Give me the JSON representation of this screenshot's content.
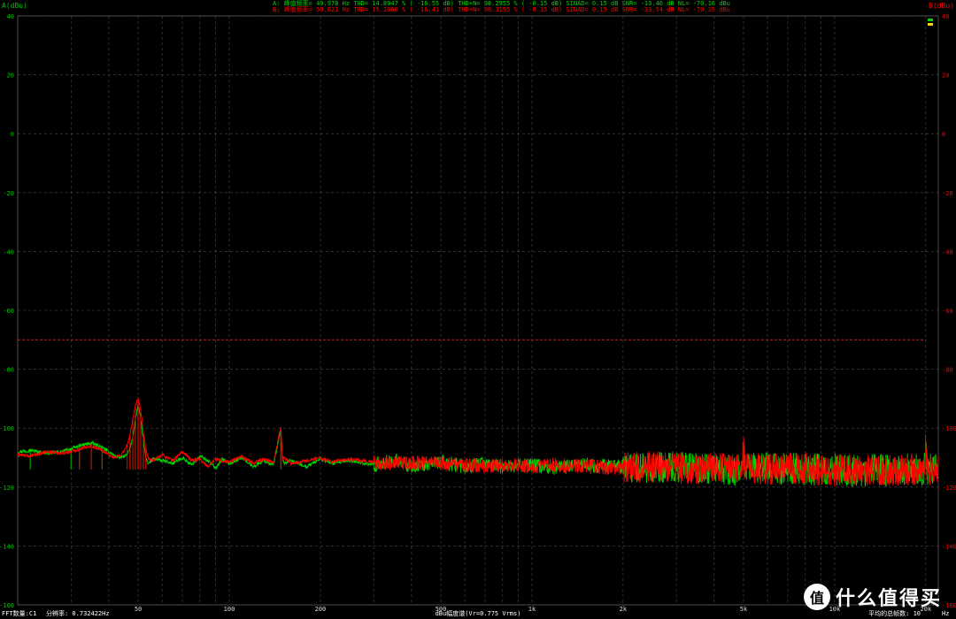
{
  "colors": {
    "background": "#000000",
    "grid": "#4d4d4d",
    "channel_a": "#00d400",
    "channel_b": "#ff0000",
    "axis_left": "#00c000",
    "axis_right": "#ff0000",
    "tick_text": "#dddddd",
    "threshold": "#c82020"
  },
  "header": {
    "line_a": "A:  峰值频率=   49.978  Hz   THD= 14.8947 % ( -16.55 dB)   THD+N= 98.2955 % (  -0.15 dB)   SINAD=   0.15 dB   SNR= -13.46 dB   NL= -70.16 dBu",
    "line_b": "B:  峰值频率=   50.021  Hz   THD= 15.1066 % ( -16.41 dB)   THD+N= 98.3195 % (  -0.15 dB)   SINAD=   0.15 dB   SNR= -13.54 dB   NL= -70.15 dBu"
  },
  "chart_data": {
    "type": "line",
    "x_scale": "log",
    "xlim": [
      20,
      22000
    ],
    "ylim": [
      -160,
      40
    ],
    "y_ticks": [
      40,
      20,
      0,
      -20,
      -40,
      -60,
      -80,
      -100,
      -120,
      -140,
      -160
    ],
    "x_tick_labels": [
      {
        "x": 50,
        "label": "50"
      },
      {
        "x": 100,
        "label": "100"
      },
      {
        "x": 200,
        "label": "200"
      },
      {
        "x": 500,
        "label": "500"
      },
      {
        "x": 1000,
        "label": "1k"
      },
      {
        "x": 2000,
        "label": "2k"
      },
      {
        "x": 5000,
        "label": "5k"
      },
      {
        "x": 10000,
        "label": "10k"
      },
      {
        "x": 20000,
        "label": "20k"
      }
    ],
    "ylabel_left": "A(dBu)",
    "ylabel_right": "B(dBu)",
    "xlabel_unit": "Hz",
    "xlabel": "dBu幅度谱(Vr=0.775 Vrms)",
    "threshold_dbu": -70,
    "series": [
      {
        "name": "A",
        "color": "#00d400",
        "points": [
          [
            20,
            -108
          ],
          [
            22,
            -107.5
          ],
          [
            25,
            -108.5
          ],
          [
            28,
            -108
          ],
          [
            30,
            -107
          ],
          [
            32,
            -106
          ],
          [
            35,
            -105
          ],
          [
            38,
            -106.5
          ],
          [
            40,
            -108
          ],
          [
            42,
            -109.5
          ],
          [
            44,
            -110
          ],
          [
            46,
            -109
          ],
          [
            47,
            -107
          ],
          [
            48,
            -103
          ],
          [
            49,
            -97
          ],
          [
            49.978,
            -92
          ],
          [
            51,
            -97
          ],
          [
            52,
            -104
          ],
          [
            53,
            -110
          ],
          [
            54,
            -112
          ],
          [
            56,
            -110.5
          ],
          [
            60,
            -111
          ],
          [
            65,
            -112
          ],
          [
            70,
            -110
          ],
          [
            75,
            -112.5
          ],
          [
            80,
            -109.5
          ],
          [
            85,
            -111
          ],
          [
            90,
            -113.5
          ],
          [
            95,
            -110.5
          ],
          [
            100,
            -112
          ],
          [
            110,
            -110
          ],
          [
            120,
            -113
          ],
          [
            130,
            -111
          ],
          [
            140,
            -112.5
          ],
          [
            150,
            -110
          ],
          [
            148,
            -100.5
          ],
          [
            152,
            -112
          ],
          [
            160,
            -111
          ],
          [
            180,
            -113
          ],
          [
            200,
            -110.5
          ],
          [
            220,
            -112
          ],
          [
            250,
            -111
          ],
          [
            300,
            -112.5
          ],
          [
            350,
            -111
          ],
          [
            400,
            -113
          ],
          [
            450,
            -112
          ],
          [
            500,
            -111.5
          ],
          [
            600,
            -113
          ],
          [
            700,
            -112
          ],
          [
            800,
            -113
          ],
          [
            1000,
            -112.5
          ],
          [
            1200,
            -113.5
          ],
          [
            1500,
            -112.5
          ],
          [
            2000,
            -113
          ],
          [
            2500,
            -113.5
          ],
          [
            3000,
            -113
          ],
          [
            4000,
            -114
          ],
          [
            4950,
            -114
          ],
          [
            5000,
            -104
          ],
          [
            5050,
            -114
          ],
          [
            6000,
            -113.5
          ],
          [
            8000,
            -114
          ],
          [
            10000,
            -114
          ],
          [
            12000,
            -114.5
          ],
          [
            15000,
            -114
          ],
          [
            19800,
            -114
          ],
          [
            20000,
            -106
          ],
          [
            20200,
            -114
          ],
          [
            22000,
            -114.5
          ]
        ]
      },
      {
        "name": "B",
        "color": "#ff0000",
        "points": [
          [
            20,
            -109
          ],
          [
            22,
            -109.5
          ],
          [
            25,
            -108
          ],
          [
            28,
            -108.5
          ],
          [
            30,
            -108
          ],
          [
            32,
            -107
          ],
          [
            35,
            -106
          ],
          [
            38,
            -107.5
          ],
          [
            40,
            -109
          ],
          [
            42,
            -110
          ],
          [
            44,
            -109
          ],
          [
            46,
            -106
          ],
          [
            47,
            -102
          ],
          [
            48,
            -97
          ],
          [
            49,
            -92.5
          ],
          [
            50.021,
            -90
          ],
          [
            51,
            -94
          ],
          [
            52,
            -101
          ],
          [
            53,
            -107
          ],
          [
            54,
            -110.5
          ],
          [
            56,
            -111
          ],
          [
            60,
            -109
          ],
          [
            65,
            -111
          ],
          [
            70,
            -108
          ],
          [
            75,
            -111
          ],
          [
            80,
            -110.5
          ],
          [
            85,
            -113
          ],
          [
            90,
            -110.5
          ],
          [
            95,
            -111
          ],
          [
            100,
            -111.5
          ],
          [
            110,
            -109.5
          ],
          [
            120,
            -112
          ],
          [
            130,
            -110.5
          ],
          [
            140,
            -111.5
          ],
          [
            148,
            -99.5
          ],
          [
            150,
            -111
          ],
          [
            152,
            -110
          ],
          [
            160,
            -112
          ],
          [
            180,
            -111
          ],
          [
            200,
            -110
          ],
          [
            220,
            -111.5
          ],
          [
            250,
            -110.5
          ],
          [
            300,
            -111.5
          ],
          [
            350,
            -112
          ],
          [
            400,
            -112
          ],
          [
            450,
            -111.5
          ],
          [
            500,
            -112
          ],
          [
            600,
            -112.5
          ],
          [
            700,
            -113
          ],
          [
            800,
            -112.5
          ],
          [
            1000,
            -113
          ],
          [
            1200,
            -112.5
          ],
          [
            1500,
            -113
          ],
          [
            2000,
            -113.5
          ],
          [
            2500,
            -113
          ],
          [
            3000,
            -113.5
          ],
          [
            4000,
            -113.5
          ],
          [
            4950,
            -113.5
          ],
          [
            5000,
            -104.5
          ],
          [
            5050,
            -113.5
          ],
          [
            6000,
            -114
          ],
          [
            8000,
            -113.5
          ],
          [
            10000,
            -114.5
          ],
          [
            12000,
            -114
          ],
          [
            15000,
            -114.5
          ],
          [
            19800,
            -114
          ],
          [
            20000,
            -105
          ],
          [
            20200,
            -114
          ],
          [
            22000,
            -114
          ]
        ]
      }
    ]
  },
  "footer": {
    "fft_label": "FFT数量:C1",
    "resolution_label": "分辨率:  0.732422Hz",
    "average_label": "平均的总帧数: 10"
  },
  "watermark": {
    "icon": "value-badge-icon",
    "badge_text": "值",
    "text": "什么值得买"
  }
}
